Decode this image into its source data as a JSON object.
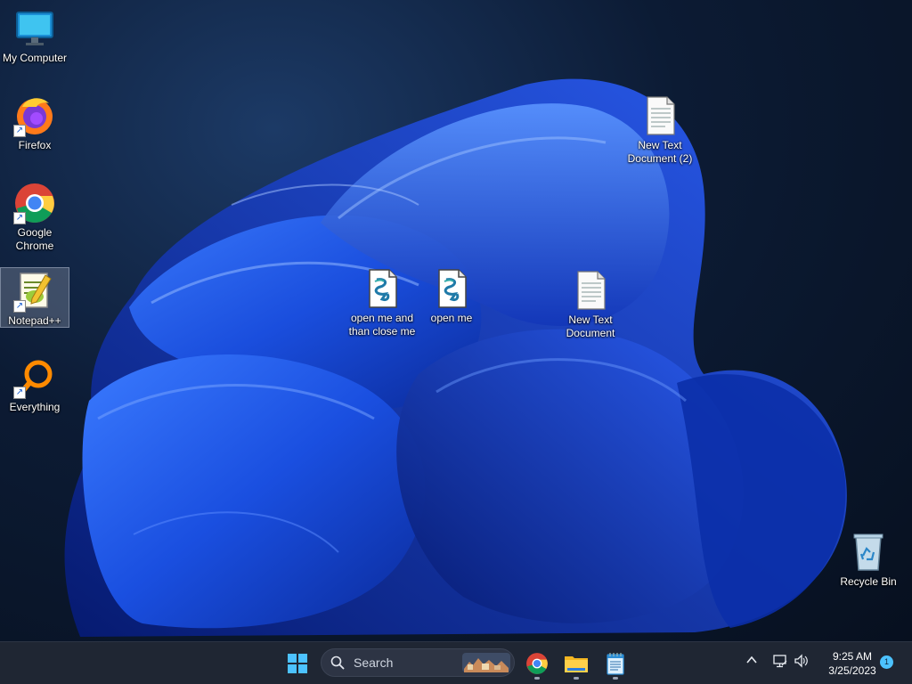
{
  "desktop": {
    "icons": [
      {
        "label": "My Computer",
        "icon": "monitor-icon"
      },
      {
        "label": "Firefox",
        "icon": "firefox-icon"
      },
      {
        "label": "Google\nChrome",
        "icon": "chrome-icon"
      },
      {
        "label": "Notepad++",
        "icon": "notepad-plus-plus-icon"
      },
      {
        "label": "Everything",
        "icon": "everything-search-icon"
      },
      {
        "label": "open me and\nthan close me",
        "icon": "script-file-icon"
      },
      {
        "label": "open me",
        "icon": "script-file-icon"
      },
      {
        "label": "New Text\nDocument",
        "icon": "text-file-icon"
      },
      {
        "label": "New Text\nDocument (2)",
        "icon": "text-file-icon"
      },
      {
        "label": "Recycle Bin",
        "icon": "recycle-bin-icon"
      }
    ]
  },
  "taskbar": {
    "search_placeholder": "Search",
    "pinned": [
      "start-icon",
      "chrome-icon",
      "file-explorer-icon",
      "notepad-icon"
    ],
    "clock": {
      "time": "9:25 AM",
      "date": "3/25/2023"
    },
    "notification_count": "1"
  },
  "colors": {
    "accent": "#1a5fd0",
    "taskbar": "#1f2633",
    "wallpaper_blue": "#1e54e6"
  }
}
